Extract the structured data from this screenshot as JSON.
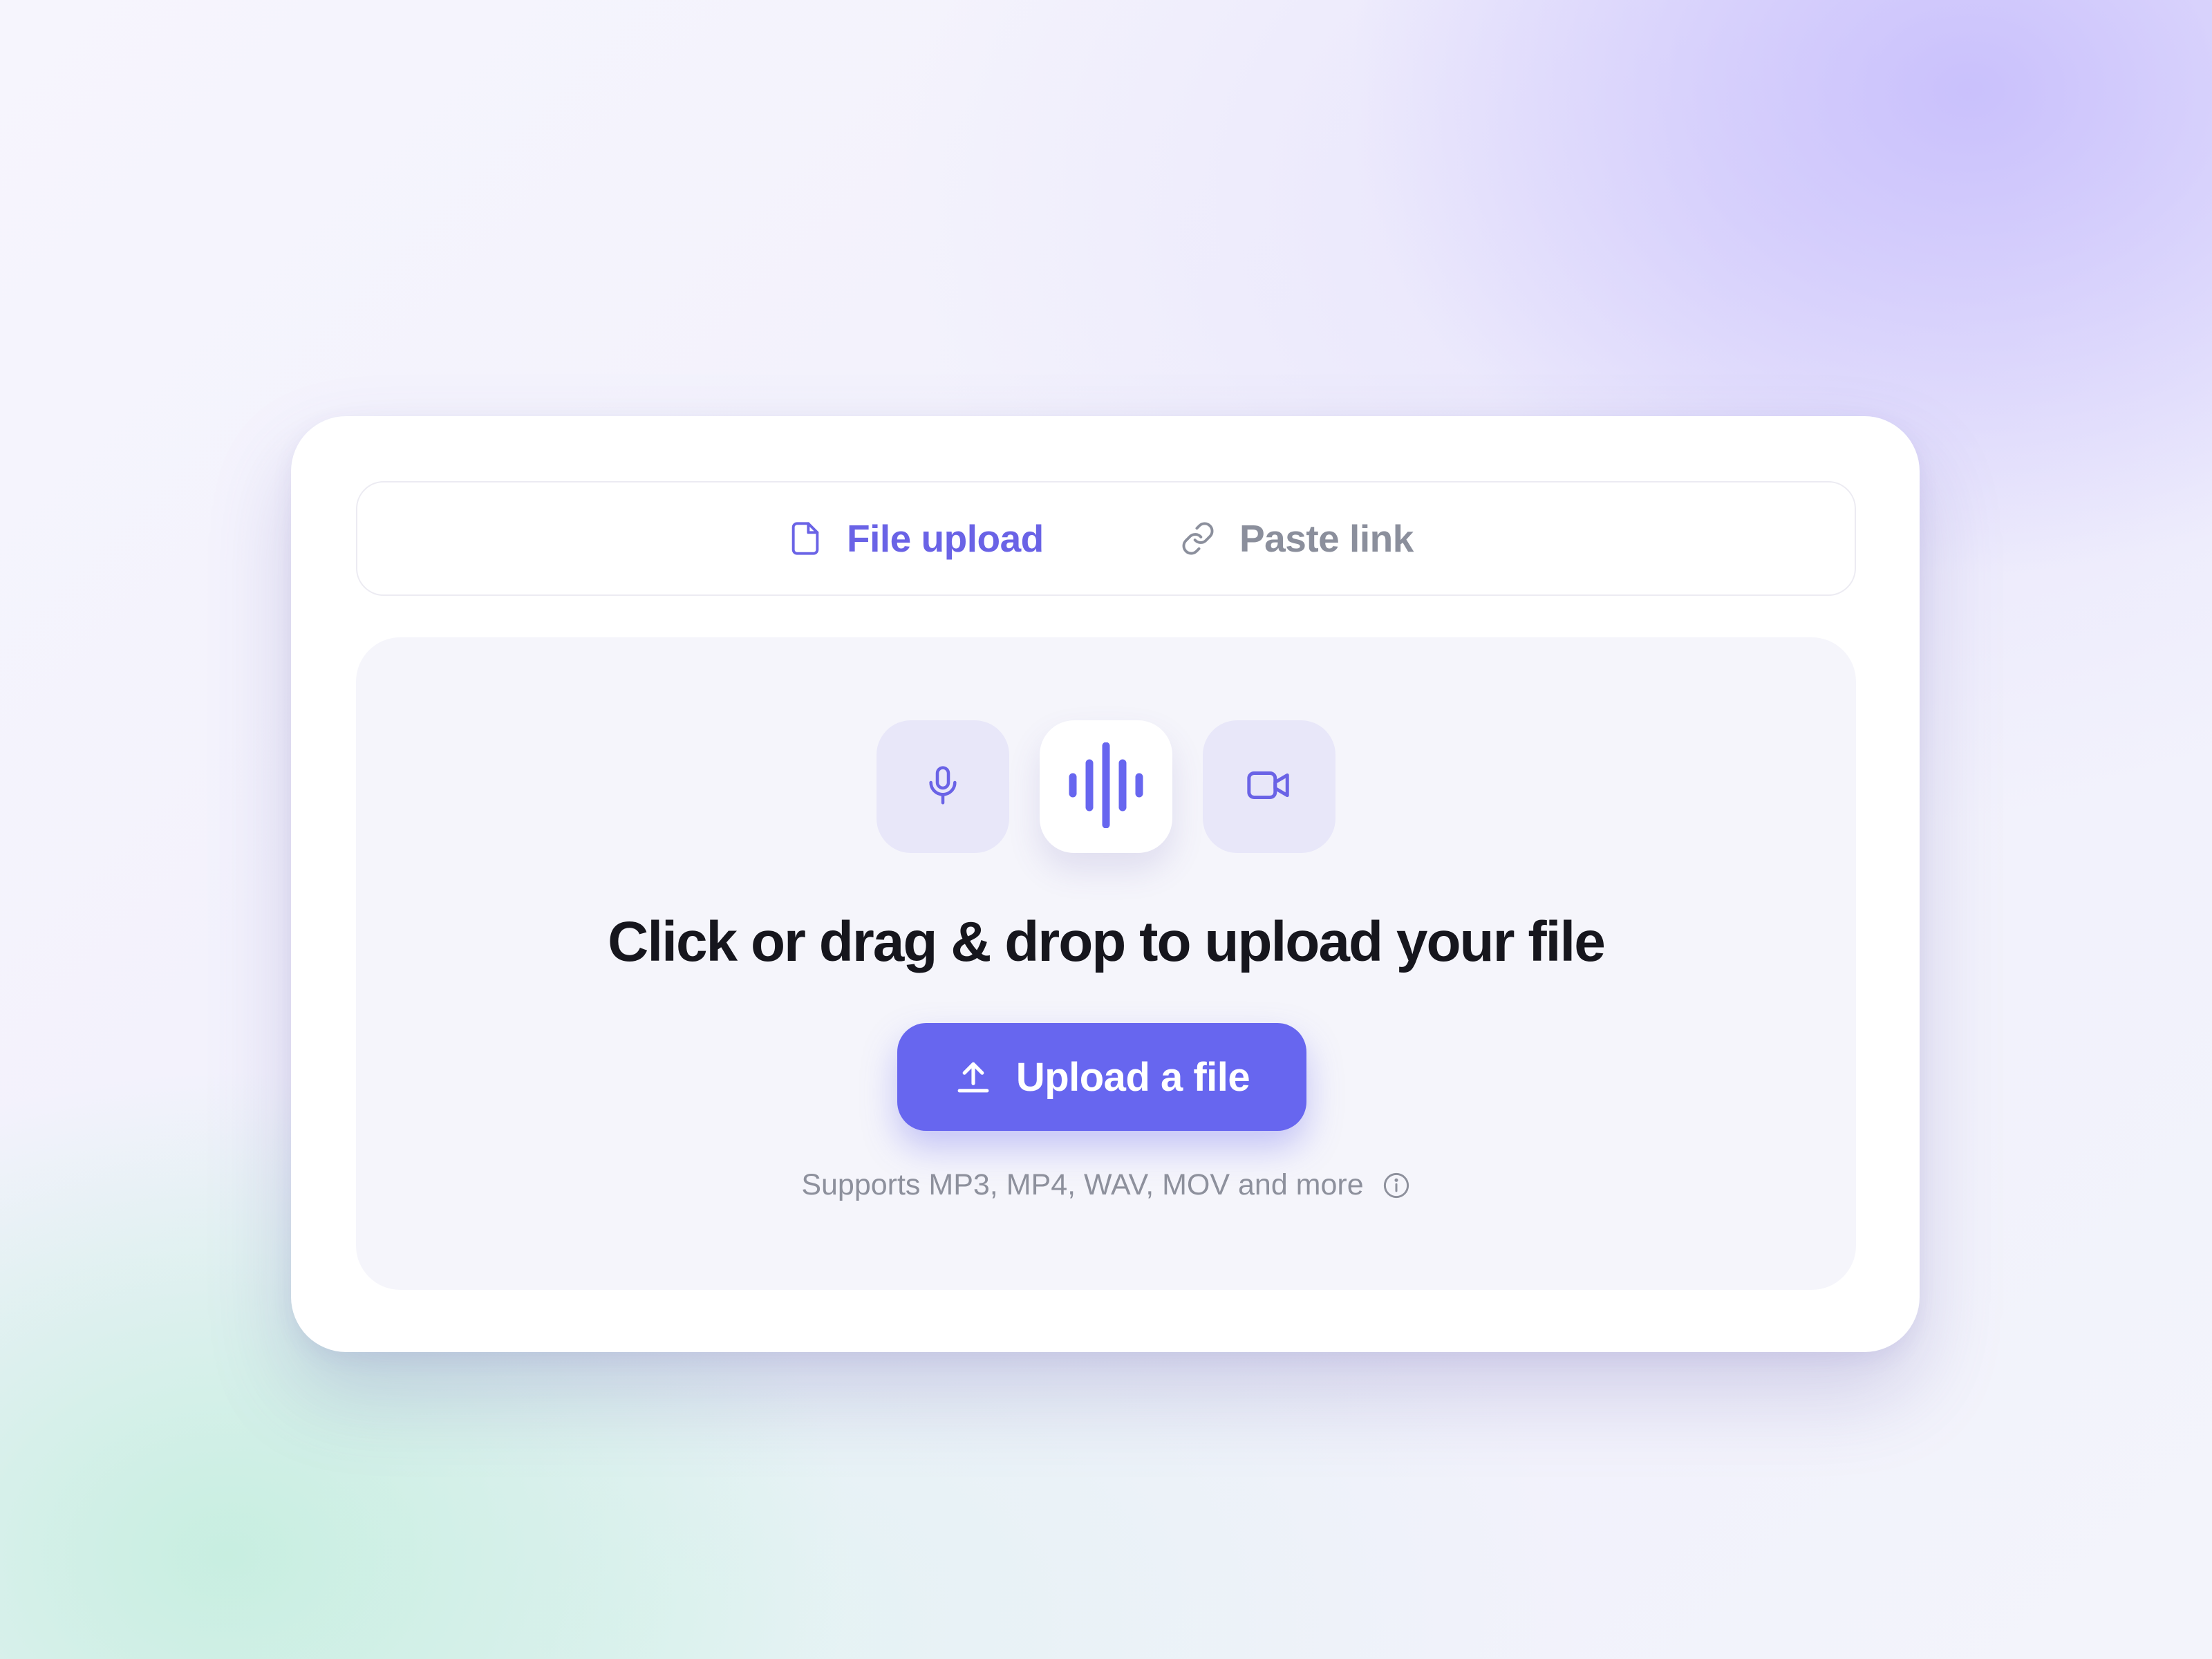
{
  "tabs": {
    "file_upload": {
      "label": "File upload",
      "icon": "file-icon",
      "active": true
    },
    "paste_link": {
      "label": "Paste link",
      "icon": "link-icon",
      "active": false
    }
  },
  "dropzone": {
    "media_types": [
      {
        "icon": "microphone-icon"
      },
      {
        "icon": "audio-waveform-icon"
      },
      {
        "icon": "video-camera-icon"
      }
    ],
    "headline": "Click or drag & drop to upload your file",
    "upload_button": {
      "label": "Upload a file",
      "icon": "upload-icon"
    },
    "supports_text": "Supports MP3, MP4, WAV, MOV and more",
    "info_icon": "info-icon"
  },
  "colors": {
    "accent": "#6766ef",
    "accent_text": "#6a63e6",
    "inactive_text": "#8b8f9c",
    "headline": "#16161d",
    "tile_bg": "#e8e7f9",
    "dropzone_bg": "#f5f5fb"
  }
}
